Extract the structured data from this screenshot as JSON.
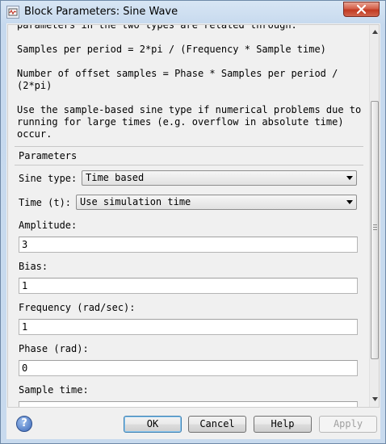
{
  "window": {
    "title": "Block Parameters: Sine Wave"
  },
  "description": {
    "lines": [
      "parameters in the two types are related through:",
      "Samples per period = 2*pi / (Frequency * Sample time)",
      "Number of offset samples = Phase * Samples per period /",
      "(2*pi)",
      "Use the sample-based sine type if numerical problems due to",
      "running for large times (e.g. overflow in absolute time)",
      "occur."
    ]
  },
  "parameters": {
    "section_label": "Parameters",
    "sine_type": {
      "label": "Sine type:",
      "value": "Time based"
    },
    "time": {
      "label": "Time (t):",
      "value": "Use simulation time"
    },
    "amplitude": {
      "label": "Amplitude:",
      "value": "3"
    },
    "bias": {
      "label": "Bias:",
      "value": "1"
    },
    "frequency": {
      "label": "Frequency (rad/sec):",
      "value": "1"
    },
    "phase": {
      "label": "Phase (rad):",
      "value": "0"
    },
    "sample_time": {
      "label": "Sample time:"
    }
  },
  "buttons": {
    "ok": "OK",
    "cancel": "Cancel",
    "help": "Help",
    "apply": "Apply",
    "help_icon": "?"
  },
  "icons": {
    "app": "simulink-block-icon",
    "close": "close-icon",
    "help": "question-icon",
    "scroll_up": "scroll-up-arrow-icon",
    "scroll_down": "scroll-down-arrow-icon"
  },
  "colors": {
    "close_button": "#c9432b",
    "default_button_border": "#3c7fb1",
    "disabled_text": "#a0a0a0"
  }
}
